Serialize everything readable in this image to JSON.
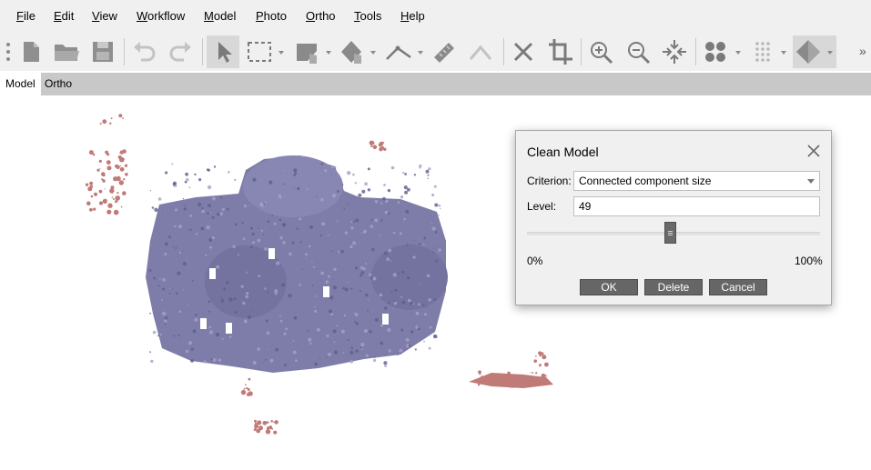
{
  "menubar": {
    "items": [
      {
        "accel": "F",
        "rest": "ile"
      },
      {
        "accel": "E",
        "rest": "dit"
      },
      {
        "accel": "V",
        "rest": "iew"
      },
      {
        "accel": "W",
        "rest": "orkflow"
      },
      {
        "accel": "M",
        "rest": "odel"
      },
      {
        "accel": "P",
        "rest": "hoto"
      },
      {
        "accel": "O",
        "rest": "rtho"
      },
      {
        "accel": "T",
        "rest": "ools"
      },
      {
        "accel": "H",
        "rest": "elp"
      }
    ]
  },
  "toolbar": {
    "overflow_label": "»",
    "icons": [
      "new-document-icon",
      "open-folder-icon",
      "save-icon",
      "undo-icon",
      "redo-icon",
      "navigation-pointer-icon",
      "rectangle-selection-icon",
      "draw-shape-icon",
      "ruler-point-icon",
      "polyline-icon",
      "ruler-icon",
      "shape-tool-icon",
      "delete-icon",
      "crop-icon",
      "zoom-in-icon",
      "zoom-out-icon",
      "reset-view-icon",
      "show-points-icon",
      "show-grid-icon",
      "shaded-model-icon"
    ]
  },
  "tabs": [
    {
      "label": "Model",
      "active": true
    },
    {
      "label": "Ortho",
      "active": false
    }
  ],
  "viewport": {
    "mesh_color": "#7e7ca8",
    "fragment_color": "#c07a78"
  },
  "dialog": {
    "title": "Clean Model",
    "criterion_label": "Criterion:",
    "criterion_value": "Connected component size",
    "level_label": "Level:",
    "level_value": "49",
    "slider_fraction": 0.49,
    "min_label": "0%",
    "max_label": "100%",
    "ok_label": "OK",
    "delete_label": "Delete",
    "cancel_label": "Cancel"
  }
}
